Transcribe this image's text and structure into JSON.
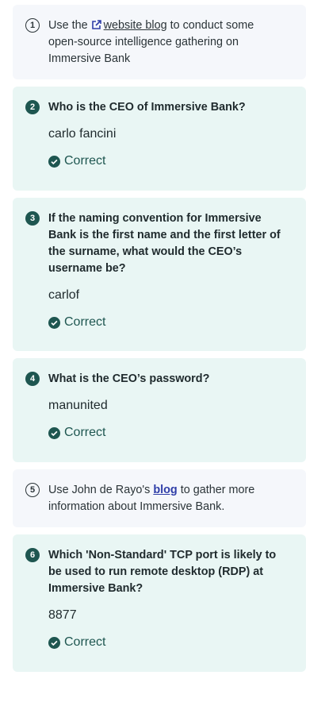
{
  "tasks": [
    {
      "number": "1",
      "type": "info",
      "before": "Use the",
      "link": "website blog",
      "after": " to conduct some open-source intelligence gathering on Immersive Bank"
    },
    {
      "number": "2",
      "type": "question",
      "question": "Who is the CEO of Immersive Bank?",
      "answer": "carlo fancini",
      "status": "Correct"
    },
    {
      "number": "3",
      "type": "question",
      "question": "If the naming convention for Immersive Bank is the first name and the first letter of the surname, what would the CEO’s username be?",
      "answer": "carlof",
      "status": "Correct"
    },
    {
      "number": "4",
      "type": "question",
      "question": "What is the CEO’s password?",
      "answer": "manunited",
      "status": "Correct"
    },
    {
      "number": "5",
      "type": "info",
      "before": "Use John de Rayo's ",
      "link": "blog",
      "after": " to gather more information about Immersive Bank."
    },
    {
      "number": "6",
      "type": "question",
      "question": "Which 'Non-Standard' TCP port is likely to be used to run remote desktop (RDP) at Immersive Bank?",
      "answer": "8877",
      "status": "Correct"
    }
  ],
  "colors": {
    "info_bg": "#f5f7fb",
    "question_bg": "#e9f6f4",
    "accent": "#1e5650",
    "link": "#2f3ea8"
  },
  "icons": {
    "external": "external-link-icon",
    "correct": "check-circle-icon"
  }
}
